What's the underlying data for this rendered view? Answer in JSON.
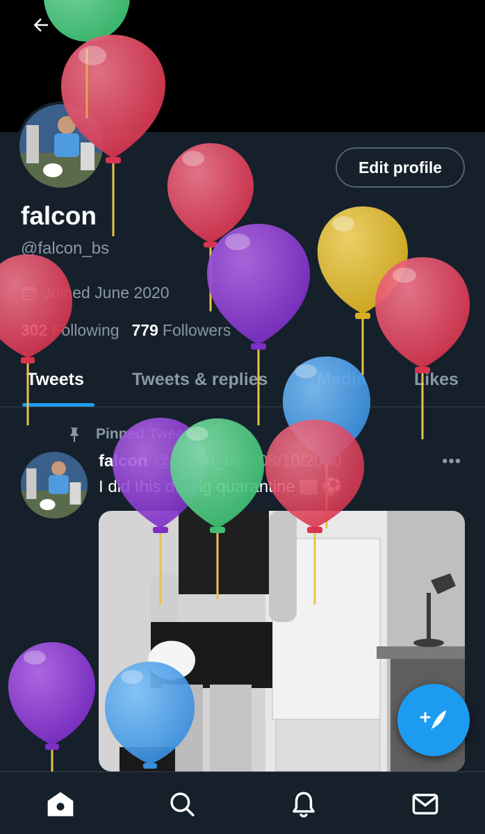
{
  "profile": {
    "display_name": "falcon",
    "handle": "@falcon_bs",
    "joined": "Joined June 2020",
    "following_count": "302",
    "following_label": "Following",
    "followers_count": "779",
    "followers_label": "Followers",
    "edit_button": "Edit profile"
  },
  "tabs": [
    "Tweets",
    "Tweets & replies",
    "Media",
    "Likes"
  ],
  "tweet": {
    "pinned_label": "Pinned Tweet",
    "name": "falcon",
    "handle": "@falcon_bs",
    "separator": "·",
    "date": "08/10/2020",
    "more": "•••",
    "text": "I did this during quarantine",
    "emoji": "⚽"
  },
  "icons": {
    "back": "arrow-left-icon",
    "calendar": "calendar-icon",
    "pin": "pin-icon",
    "compose": "compose-tweet-icon",
    "home": "home-icon",
    "search": "search-icon",
    "notifications": "bell-icon",
    "messages": "mail-icon"
  },
  "colors": {
    "background": "#15202b",
    "accent": "#1d9bf0",
    "muted": "#8b98a5",
    "border": "#38444d"
  }
}
